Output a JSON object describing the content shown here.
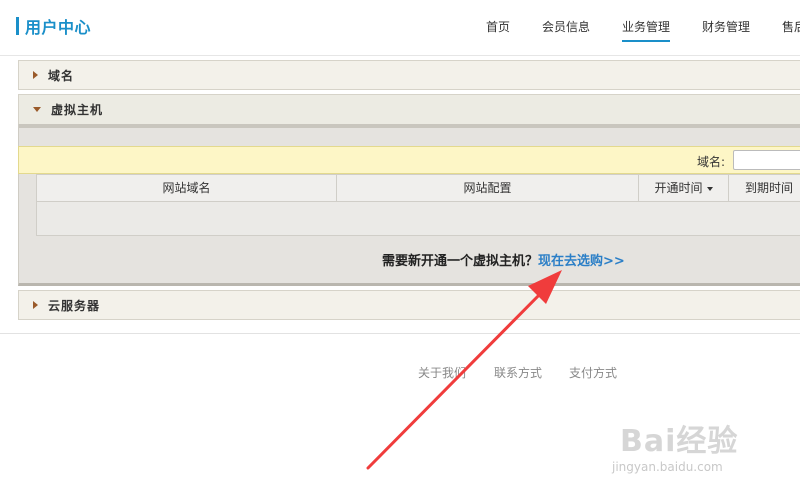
{
  "header": {
    "brand_title": "用户中心",
    "brand_color": "#1a8fc9",
    "nav": [
      {
        "label": "首页",
        "active": false
      },
      {
        "label": "会员信息",
        "active": false
      },
      {
        "label": "业务管理",
        "active": true
      },
      {
        "label": "财务管理",
        "active": false
      },
      {
        "label": "售后",
        "active": false
      }
    ]
  },
  "panels": [
    {
      "title": "域名",
      "expanded": false,
      "icon": "triangle-right-icon"
    },
    {
      "title": "虚拟主机",
      "expanded": true,
      "icon": "triangle-down-icon"
    },
    {
      "title": "云服务器",
      "expanded": false,
      "icon": "triangle-right-icon"
    }
  ],
  "vhost": {
    "search_label": "域名:",
    "search_value": "",
    "columns": [
      "网站域名",
      "网站配置",
      "开通时间",
      "到期时间"
    ],
    "sort_column": "开通时间",
    "rows": [],
    "cta_question": "需要新开通一个虚拟主机？",
    "cta_link": "现在去选购>>"
  },
  "footer": {
    "links": [
      "关于我们",
      "联系方式",
      "支付方式"
    ]
  },
  "watermark": {
    "brand": "Bai经验",
    "url": "jingyan.baidu.com"
  },
  "colors": {
    "link": "#2b7fc7",
    "annotation_arrow": "#f03c3c",
    "panel_arrow": "#9a5a2a"
  }
}
